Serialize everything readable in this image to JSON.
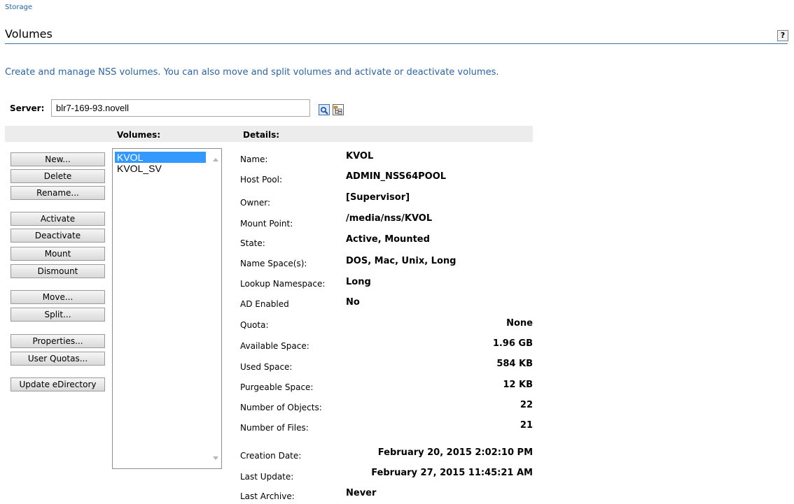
{
  "breadcrumb": "Storage",
  "page_title": "Volumes",
  "help_label": "?",
  "description": "Create and manage NSS volumes. You can also move and split volumes and activate or deactivate volumes.",
  "server": {
    "label": "Server:",
    "value": "blr7-169-93.novell"
  },
  "columns": {
    "volumes": "Volumes:",
    "details": "Details:"
  },
  "buttons": {
    "new": "New...",
    "delete": "Delete",
    "rename": "Rename...",
    "activate": "Activate",
    "deactivate": "Deactivate",
    "mount": "Mount",
    "dismount": "Dismount",
    "move": "Move...",
    "split": "Split...",
    "properties": "Properties...",
    "user_quotas": "User Quotas...",
    "update_edirectory": "Update eDirectory"
  },
  "volumes": [
    {
      "name": "KVOL",
      "selected": true
    },
    {
      "name": "KVOL_SV",
      "selected": false
    }
  ],
  "details": [
    {
      "label": "Name:",
      "value": "KVOL"
    },
    {
      "label": "Host Pool:",
      "value": "ADMIN_NSS64POOL"
    },
    {
      "label": "Owner:",
      "value": "[Supervisor]"
    },
    {
      "label": "Mount Point:",
      "value": "/media/nss/KVOL"
    },
    {
      "label": "State:",
      "value": "Active, Mounted"
    },
    {
      "label": "Name Space(s):",
      "value": "DOS, Mac, Unix, Long"
    },
    {
      "label": "Lookup Namespace:",
      "value": "Long"
    },
    {
      "label": "AD Enabled",
      "value": "No"
    },
    {
      "label": "Quota:",
      "value": "None"
    },
    {
      "label": "Available Space:",
      "value": "1.96 GB"
    },
    {
      "label": "Used Space:",
      "value": "584 KB"
    },
    {
      "label": "Purgeable Space:",
      "value": "12 KB"
    },
    {
      "label": "Number of Objects:",
      "value": "22"
    },
    {
      "label": "Number of Files:",
      "value": "21"
    },
    {
      "label": "Creation Date:",
      "value": "February 20, 2015 2:02:10 PM"
    },
    {
      "label": "Last Update:",
      "value": "February 27, 2015 11:45:21 AM"
    },
    {
      "label": "Last Archive:",
      "value": "Never"
    }
  ],
  "colors": {
    "link": "#1d63a8",
    "description": "#2b64a8",
    "selection": "#3399ff",
    "title_rule": "#3a72a8"
  },
  "icons": [
    "search-icon",
    "tree-browse-icon",
    "help-icon"
  ]
}
